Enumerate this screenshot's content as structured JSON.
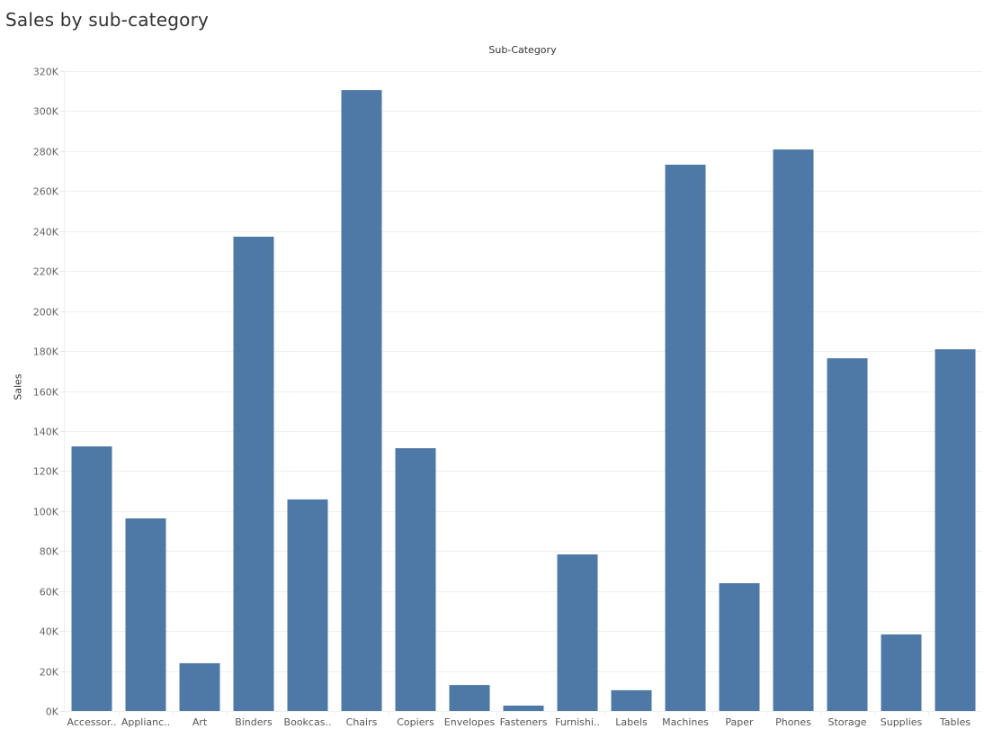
{
  "chart_data": {
    "type": "bar",
    "title": "Sales by sub-category",
    "xlabel": "Sub-Category",
    "ylabel": "Sales",
    "ylim": [
      0,
      320000
    ],
    "yticks": [
      0,
      20000,
      40000,
      60000,
      80000,
      100000,
      120000,
      140000,
      160000,
      180000,
      200000,
      220000,
      240000,
      260000,
      280000,
      300000,
      320000
    ],
    "ytick_labels": [
      "0K",
      "20K",
      "40K",
      "60K",
      "80K",
      "100K",
      "120K",
      "140K",
      "160K",
      "180K",
      "200K",
      "220K",
      "240K",
      "260K",
      "280K",
      "300K",
      "320K"
    ],
    "grid": true,
    "bar_color": "#4e79a7",
    "categories": [
      "Accessories",
      "Appliances",
      "Art",
      "Binders",
      "Bookcases",
      "Chairs",
      "Copiers",
      "Envelopes",
      "Fasteners",
      "Furnishings",
      "Labels",
      "Machines",
      "Paper",
      "Phones",
      "Storage",
      "Supplies",
      "Tables"
    ],
    "category_labels": [
      "Accessor..",
      "Applianc..",
      "Art",
      "Binders",
      "Bookcas..",
      "Chairs",
      "Copiers",
      "Envelopes",
      "Fasteners",
      "Furnishi..",
      "Labels",
      "Machines",
      "Paper",
      "Phones",
      "Storage",
      "Supplies",
      "Tables"
    ],
    "values": [
      132300,
      96300,
      23900,
      237200,
      105800,
      310500,
      131400,
      13000,
      2700,
      78300,
      10400,
      273200,
      63900,
      280800,
      176400,
      38300,
      180900
    ]
  }
}
